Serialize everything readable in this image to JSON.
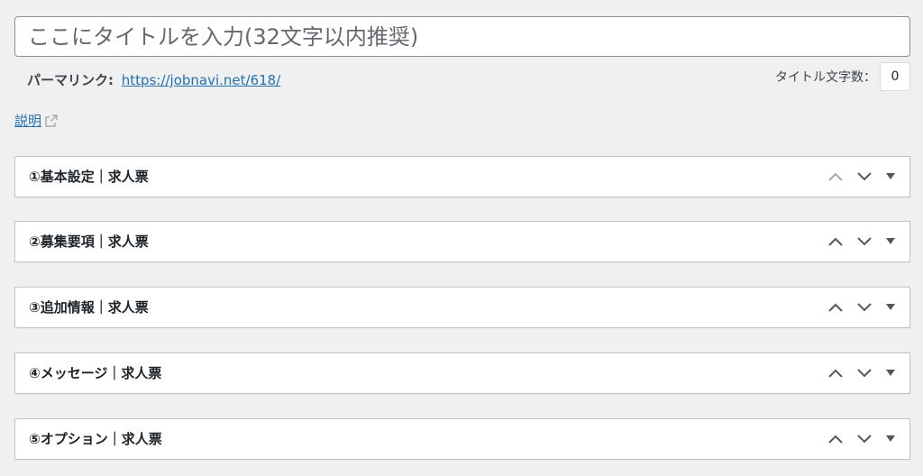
{
  "title_field": {
    "value": "",
    "placeholder": "ここにタイトルを入力(32文字以内推奨)"
  },
  "permalink": {
    "label": "パーマリンク:",
    "url": "https://jobnavi.net/618/"
  },
  "title_counter": {
    "label": "タイトル文字数：",
    "value": "0"
  },
  "description_link": "説明",
  "metaboxes": [
    {
      "title": "①基本設定｜求人票",
      "move_up_enabled": false
    },
    {
      "title": "②募集要項｜求人票",
      "move_up_enabled": true
    },
    {
      "title": "③追加情報｜求人票",
      "move_up_enabled": true
    },
    {
      "title": "④メッセージ｜求人票",
      "move_up_enabled": true
    },
    {
      "title": "⑤オプション｜求人票",
      "move_up_enabled": true
    }
  ],
  "icons": {
    "move_up": "chevron-up-icon",
    "move_down": "chevron-down-icon",
    "toggle": "triangle-down-icon",
    "external": "external-link-icon"
  },
  "colors": {
    "background": "#f0f0f1",
    "link": "#2271b1",
    "border": "#c3c4c7",
    "icon_active": "#50575e",
    "icon_disabled": "#a7aaad"
  }
}
